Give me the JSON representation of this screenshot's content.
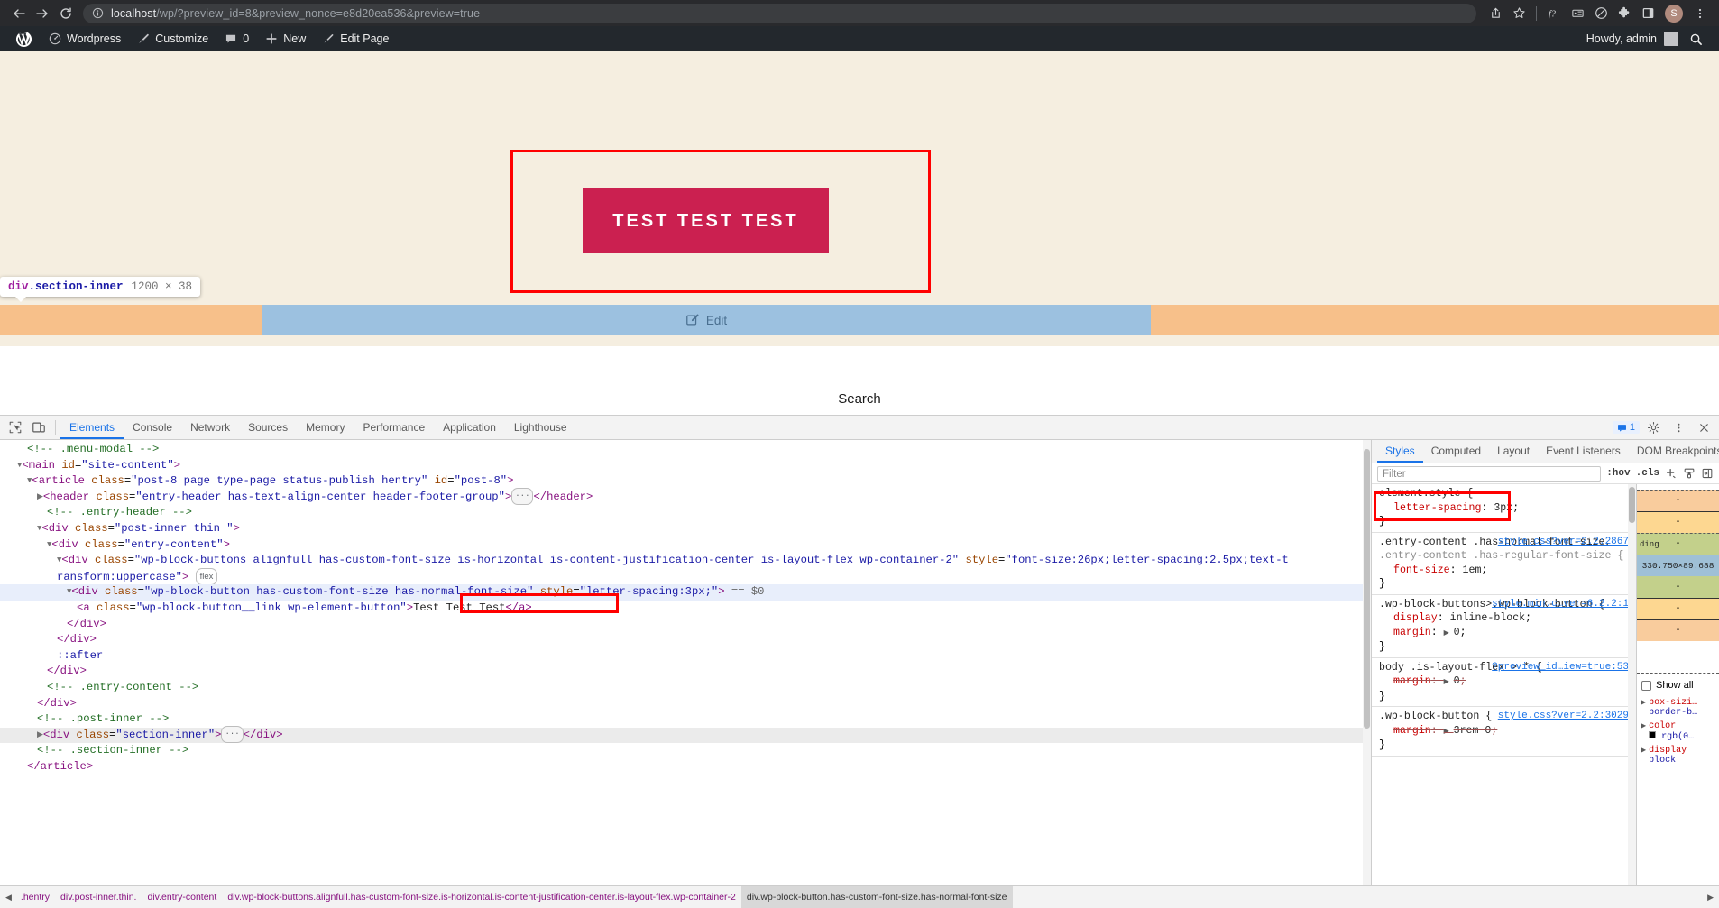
{
  "browser": {
    "back_icon": "back-arrow-icon",
    "forward_icon": "forward-arrow-icon",
    "reload_icon": "reload-icon",
    "site_info_icon": "info-circle-icon",
    "url_host": "localhost",
    "url_path": "/wp/?preview_id=8&preview_nonce=e8d20ea536&preview=true",
    "url_full": "localhost/wp/?preview_id=8&preview_nonce=e8d20ea536&preview=true",
    "toolbar_icons": [
      "share-icon",
      "star-bookmark-icon",
      "function-fx-icon",
      "devtools-device-icon",
      "block-circle-icon",
      "extensions-puzzle-icon",
      "side-panel-icon"
    ],
    "profile_initial": "S",
    "menu_icon": "three-dot-menu-icon"
  },
  "adminbar": {
    "logo": "wordpress-logo-icon",
    "items": [
      {
        "label": "Wordpress",
        "icon": "dashboard-icon"
      },
      {
        "label": "Customize",
        "icon": "paintbrush-icon"
      },
      {
        "label": "0",
        "icon": "comment-bubble-icon"
      },
      {
        "label": "New",
        "icon": "plus-icon"
      },
      {
        "label": "Edit Page",
        "icon": "pencil-icon"
      }
    ],
    "howdy": "Howdy, admin",
    "avatar": "user-avatar-icon",
    "search_icon": "magnifier-icon"
  },
  "page": {
    "button_label": "Test Test Test",
    "button_color": "#cb2050",
    "background_color": "#f5eee0",
    "highlight_border_color": "#ff0000",
    "edit_overlay_label": "Edit",
    "edit_overlay_icon": "edit-pencil-square-icon",
    "search_label": "Search",
    "tooltip": {
      "tag": "div",
      "class": ".section-inner",
      "dimensions": "1200 × 38"
    }
  },
  "devtools": {
    "tool_icons": [
      "inspect-element-icon",
      "device-toolbar-icon"
    ],
    "tabs": [
      "Elements",
      "Console",
      "Network",
      "Sources",
      "Memory",
      "Performance",
      "Application",
      "Lighthouse"
    ],
    "active_tab": "Elements",
    "message_count": "1",
    "settings_icon": "gear-icon",
    "more_icon": "three-dot-menu-icon",
    "close_icon": "close-x-icon",
    "dom_lines": [
      {
        "indent": 2,
        "html": "<span class=\"cm\">&lt;!-- .menu-modal --&gt;</span>"
      },
      {
        "indent": 1,
        "html": "<span class=\"tw\">▼</span><span class=\"tg\">&lt;main</span> <span class=\"at\">id</span>=<span class=\"av\">\"site-content\"</span><span class=\"tg\">&gt;</span>"
      },
      {
        "indent": 2,
        "html": "<span class=\"tw\">▼</span><span class=\"tg\">&lt;article</span> <span class=\"at\">class</span>=<span class=\"av\">\"post-8 page type-page status-publish hentry\"</span> <span class=\"at\">id</span>=<span class=\"av\">\"post-8\"</span><span class=\"tg\">&gt;</span>"
      },
      {
        "indent": 3,
        "html": "<span class=\"tw\">▶</span><span class=\"tg\">&lt;header</span> <span class=\"at\">class</span>=<span class=\"av\">\"entry-header has-text-align-center header-footer-group\"</span><span class=\"tg\">&gt;</span><span class=\"ellip\">···</span><span class=\"tg\">&lt;/header&gt;</span>"
      },
      {
        "indent": 4,
        "html": "<span class=\"cm\">&lt;!-- .entry-header --&gt;</span>"
      },
      {
        "indent": 3,
        "html": "<span class=\"tw\">▼</span><span class=\"tg\">&lt;div</span> <span class=\"at\">class</span>=<span class=\"av\">\"post-inner thin \"</span><span class=\"tg\">&gt;</span>"
      },
      {
        "indent": 4,
        "html": "<span class=\"tw\">▼</span><span class=\"tg\">&lt;div</span> <span class=\"at\">class</span>=<span class=\"av\">\"entry-content\"</span><span class=\"tg\">&gt;</span>"
      },
      {
        "indent": 5,
        "html": "<span class=\"tw\">▼</span><span class=\"tg\">&lt;div</span> <span class=\"at\">class</span>=<span class=\"av\">\"wp-block-buttons alignfull has-custom-font-size is-horizontal is-content-justification-center is-layout-flex wp-container-2\"</span> <span class=\"at\">style</span>=<span class=\"av\">\"font-size:26px;letter-spacing:2.5px;text-t</span>"
      },
      {
        "indent": 5,
        "html": "<span class=\"av\">ransform:uppercase\"</span><span class=\"tg\">&gt;</span> <span class=\"badge-flex\">flex</span>"
      },
      {
        "indent": 6,
        "html": "<span class=\"tw\">▼</span><span class=\"tg\">&lt;div</span> <span class=\"at\">class</span>=<span class=\"av\">\"wp-block-button has-custom-font-size has-normal-font-size\"</span> <span class=\"at\">style</span>=<span class=\"av\">\"letter-spacing:3px;\"</span><span class=\"tg\">&gt;</span> <span class=\"eq\">== $0</span>",
        "selected": true
      },
      {
        "indent": 7,
        "html": "<span class=\"tg\">&lt;a</span> <span class=\"at\">class</span>=<span class=\"av\">\"wp-block-button__link wp-element-button\"</span><span class=\"tg\">&gt;</span><span class=\"tx\">Test Test Test</span><span class=\"tg\">&lt;/a&gt;</span>"
      },
      {
        "indent": 6,
        "html": "<span class=\"tg\">&lt;/div&gt;</span>"
      },
      {
        "indent": 5,
        "html": "<span class=\"tg\">&lt;/div&gt;</span>"
      },
      {
        "indent": 5,
        "html": "<span class=\"pe\">::after</span>"
      },
      {
        "indent": 4,
        "html": "<span class=\"tg\">&lt;/div&gt;</span>"
      },
      {
        "indent": 4,
        "html": "<span class=\"cm\">&lt;!-- .entry-content --&gt;</span>"
      },
      {
        "indent": 3,
        "html": "<span class=\"tg\">&lt;/div&gt;</span>"
      },
      {
        "indent": 3,
        "html": "<span class=\"cm\">&lt;!-- .post-inner --&gt;</span>"
      },
      {
        "indent": 3,
        "html": "<span class=\"tw\">▶</span><span class=\"tg\">&lt;div</span> <span class=\"at\">class</span>=<span class=\"av\">\"section-inner\"</span><span class=\"tg\">&gt;</span><span class=\"ellip\">···</span><span class=\"tg\">&lt;/div&gt;</span>",
        "hovered": true
      },
      {
        "indent": 3,
        "html": "<span class=\"cm\">&lt;!-- .section-inner --&gt;</span>"
      },
      {
        "indent": 2,
        "html": "<span class=\"tg\">&lt;/article&gt;</span>"
      }
    ],
    "styles_tabs": [
      "Styles",
      "Computed",
      "Layout",
      "Event Listeners",
      "DOM Breakpoints"
    ],
    "styles_active_tab": "Styles",
    "filter_placeholder": "Filter",
    "filter_buttons": [
      ":hov",
      ".cls"
    ],
    "filter_icons": [
      "add-rule-plus-icon",
      "class-paintbrush-icon",
      "computed-sidebar-icon"
    ],
    "rules": [
      {
        "selector": "element.style {",
        "origin": "",
        "props": [
          {
            "name": "letter-spacing",
            "value": "3px",
            "struck": false
          }
        ],
        "highlighted": true
      },
      {
        "selector": ".entry-content .has-normal-font-size,",
        "selector2": ".entry-content .has-regular-font-size {",
        "origin": "style.css?ver=2.2:2867",
        "props": [
          {
            "name": "font-size",
            "value": "1em",
            "struck": false
          }
        ]
      },
      {
        "selector": ".wp-block-buttons>.wp-block-button {",
        "origin": "style.min.c…ver=6.2.2:1",
        "props": [
          {
            "name": "display",
            "value": "inline-block",
            "struck": false
          },
          {
            "name": "margin",
            "value": "0",
            "struck": false,
            "expandable": true
          }
        ]
      },
      {
        "selector": "body .is-layout-flex > * {",
        "origin": "?preview_id…iew=true:53",
        "props": [
          {
            "name": "margin",
            "value": "0",
            "struck": true,
            "expandable": true
          }
        ]
      },
      {
        "selector": ".wp-block-button {",
        "origin": "style.css?ver=2.2:3029",
        "props": [
          {
            "name": "margin",
            "value": "3rem 0",
            "struck": true,
            "expandable": true
          }
        ]
      }
    ],
    "box_model": {
      "margin": "-",
      "border": "-",
      "padding_label": "ding",
      "padding": "-",
      "content": "330.750×89.688",
      "padding_b": "-",
      "border_b": "-",
      "margin_b": "-"
    },
    "show_all_label": "Show all",
    "computed_props": [
      {
        "name": "box-sizi…",
        "value": "border-b…",
        "swatch": false
      },
      {
        "name": "color",
        "value": "rgb(0…",
        "swatch": true
      },
      {
        "name": "display",
        "value": "block",
        "swatch": false
      }
    ],
    "breadcrumb": [
      {
        "label": ".hentry",
        "type": "c1"
      },
      {
        "label": "div.post-inner.thin.",
        "type": "c1"
      },
      {
        "label": "div.entry-content",
        "type": "c1"
      },
      {
        "label": "div.wp-block-buttons.alignfull.has-custom-font-size.is-horizontal.is-content-justification-center.is-layout-flex.wp-container-2",
        "type": "c1"
      },
      {
        "label": "div.wp-block-button.has-custom-font-size.has-normal-font-size",
        "type": "sel"
      }
    ]
  }
}
